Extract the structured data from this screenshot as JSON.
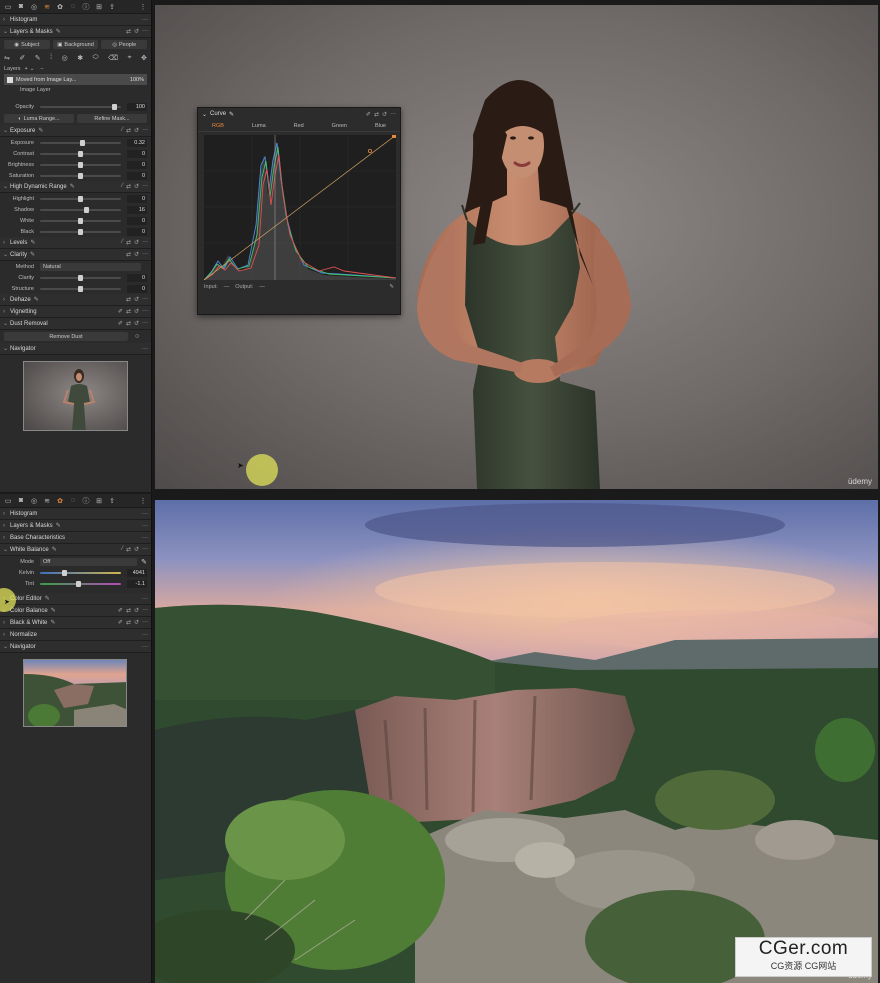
{
  "top": {
    "sections": {
      "histogram": "Histogram",
      "layers_masks": "Layers & Masks",
      "exposure": "Exposure",
      "hdr": "High Dynamic Range",
      "levels": "Levels",
      "clarity": "Clarity",
      "dehaze": "Dehaze",
      "vignetting": "Vignetting",
      "dust": "Dust Removal",
      "navigator": "Navigator"
    },
    "mask_buttons": [
      "Subject",
      "Background",
      "People"
    ],
    "layers_label": "Layers",
    "layer_name": "Moved from Image Lay...",
    "layer_opacity": "100%",
    "image_layer": "Image Layer",
    "opacity": {
      "label": "Opacity",
      "value": "100",
      "level": 0.92
    },
    "luma_range": "Luma Range...",
    "refine_mask": "Refine Mask...",
    "exposure_rows": [
      {
        "label": "Exposure",
        "value": "0.32",
        "level": 0.52
      },
      {
        "label": "Contrast",
        "value": "0",
        "level": 0.5
      },
      {
        "label": "Brightness",
        "value": "0",
        "level": 0.5
      },
      {
        "label": "Saturation",
        "value": "0",
        "level": 0.5
      }
    ],
    "hdr_rows": [
      {
        "label": "Highlight",
        "value": "0",
        "level": 0.5
      },
      {
        "label": "Shadow",
        "value": "16",
        "level": 0.58
      },
      {
        "label": "White",
        "value": "0",
        "level": 0.5
      },
      {
        "label": "Black",
        "value": "0",
        "level": 0.5
      }
    ],
    "clarity_method": {
      "label": "Method",
      "value": "Natural"
    },
    "clarity_rows": [
      {
        "label": "Clarity",
        "value": "0",
        "level": 0.5
      },
      {
        "label": "Structure",
        "value": "0",
        "level": 0.5
      }
    ],
    "remove_dust": "Remove Dust",
    "curve": {
      "title": "Curve",
      "tabs": [
        "RGB",
        "Luma",
        "Red",
        "Green",
        "Blue"
      ],
      "input": "Input:",
      "input_val": "—",
      "output": "Output:",
      "output_val": "—"
    },
    "watermark": "ūdemy"
  },
  "bottom": {
    "sections": {
      "histogram": "Histogram",
      "layers_masks": "Layers & Masks",
      "base": "Base Characteristics",
      "white_balance": "White Balance",
      "color_editor": "Color Editor",
      "color_balance": "Color Balance",
      "bw": "Black & White",
      "normalize": "Normalize",
      "navigator": "Navigator"
    },
    "wb_mode": {
      "label": "Mode",
      "value": "Off"
    },
    "kelvin": {
      "label": "Kelvin",
      "value": "4941",
      "level": 0.3
    },
    "tint": {
      "label": "Tint",
      "value": "-1.1",
      "level": 0.48
    },
    "watermark": "ūdemy"
  },
  "brand": {
    "line1": "CGer.com",
    "line2": "CG资源 CG网站"
  },
  "colors": {
    "accent": "#e58a3a",
    "panel": "#2b2b2b",
    "cursor": "#e0e25a"
  }
}
